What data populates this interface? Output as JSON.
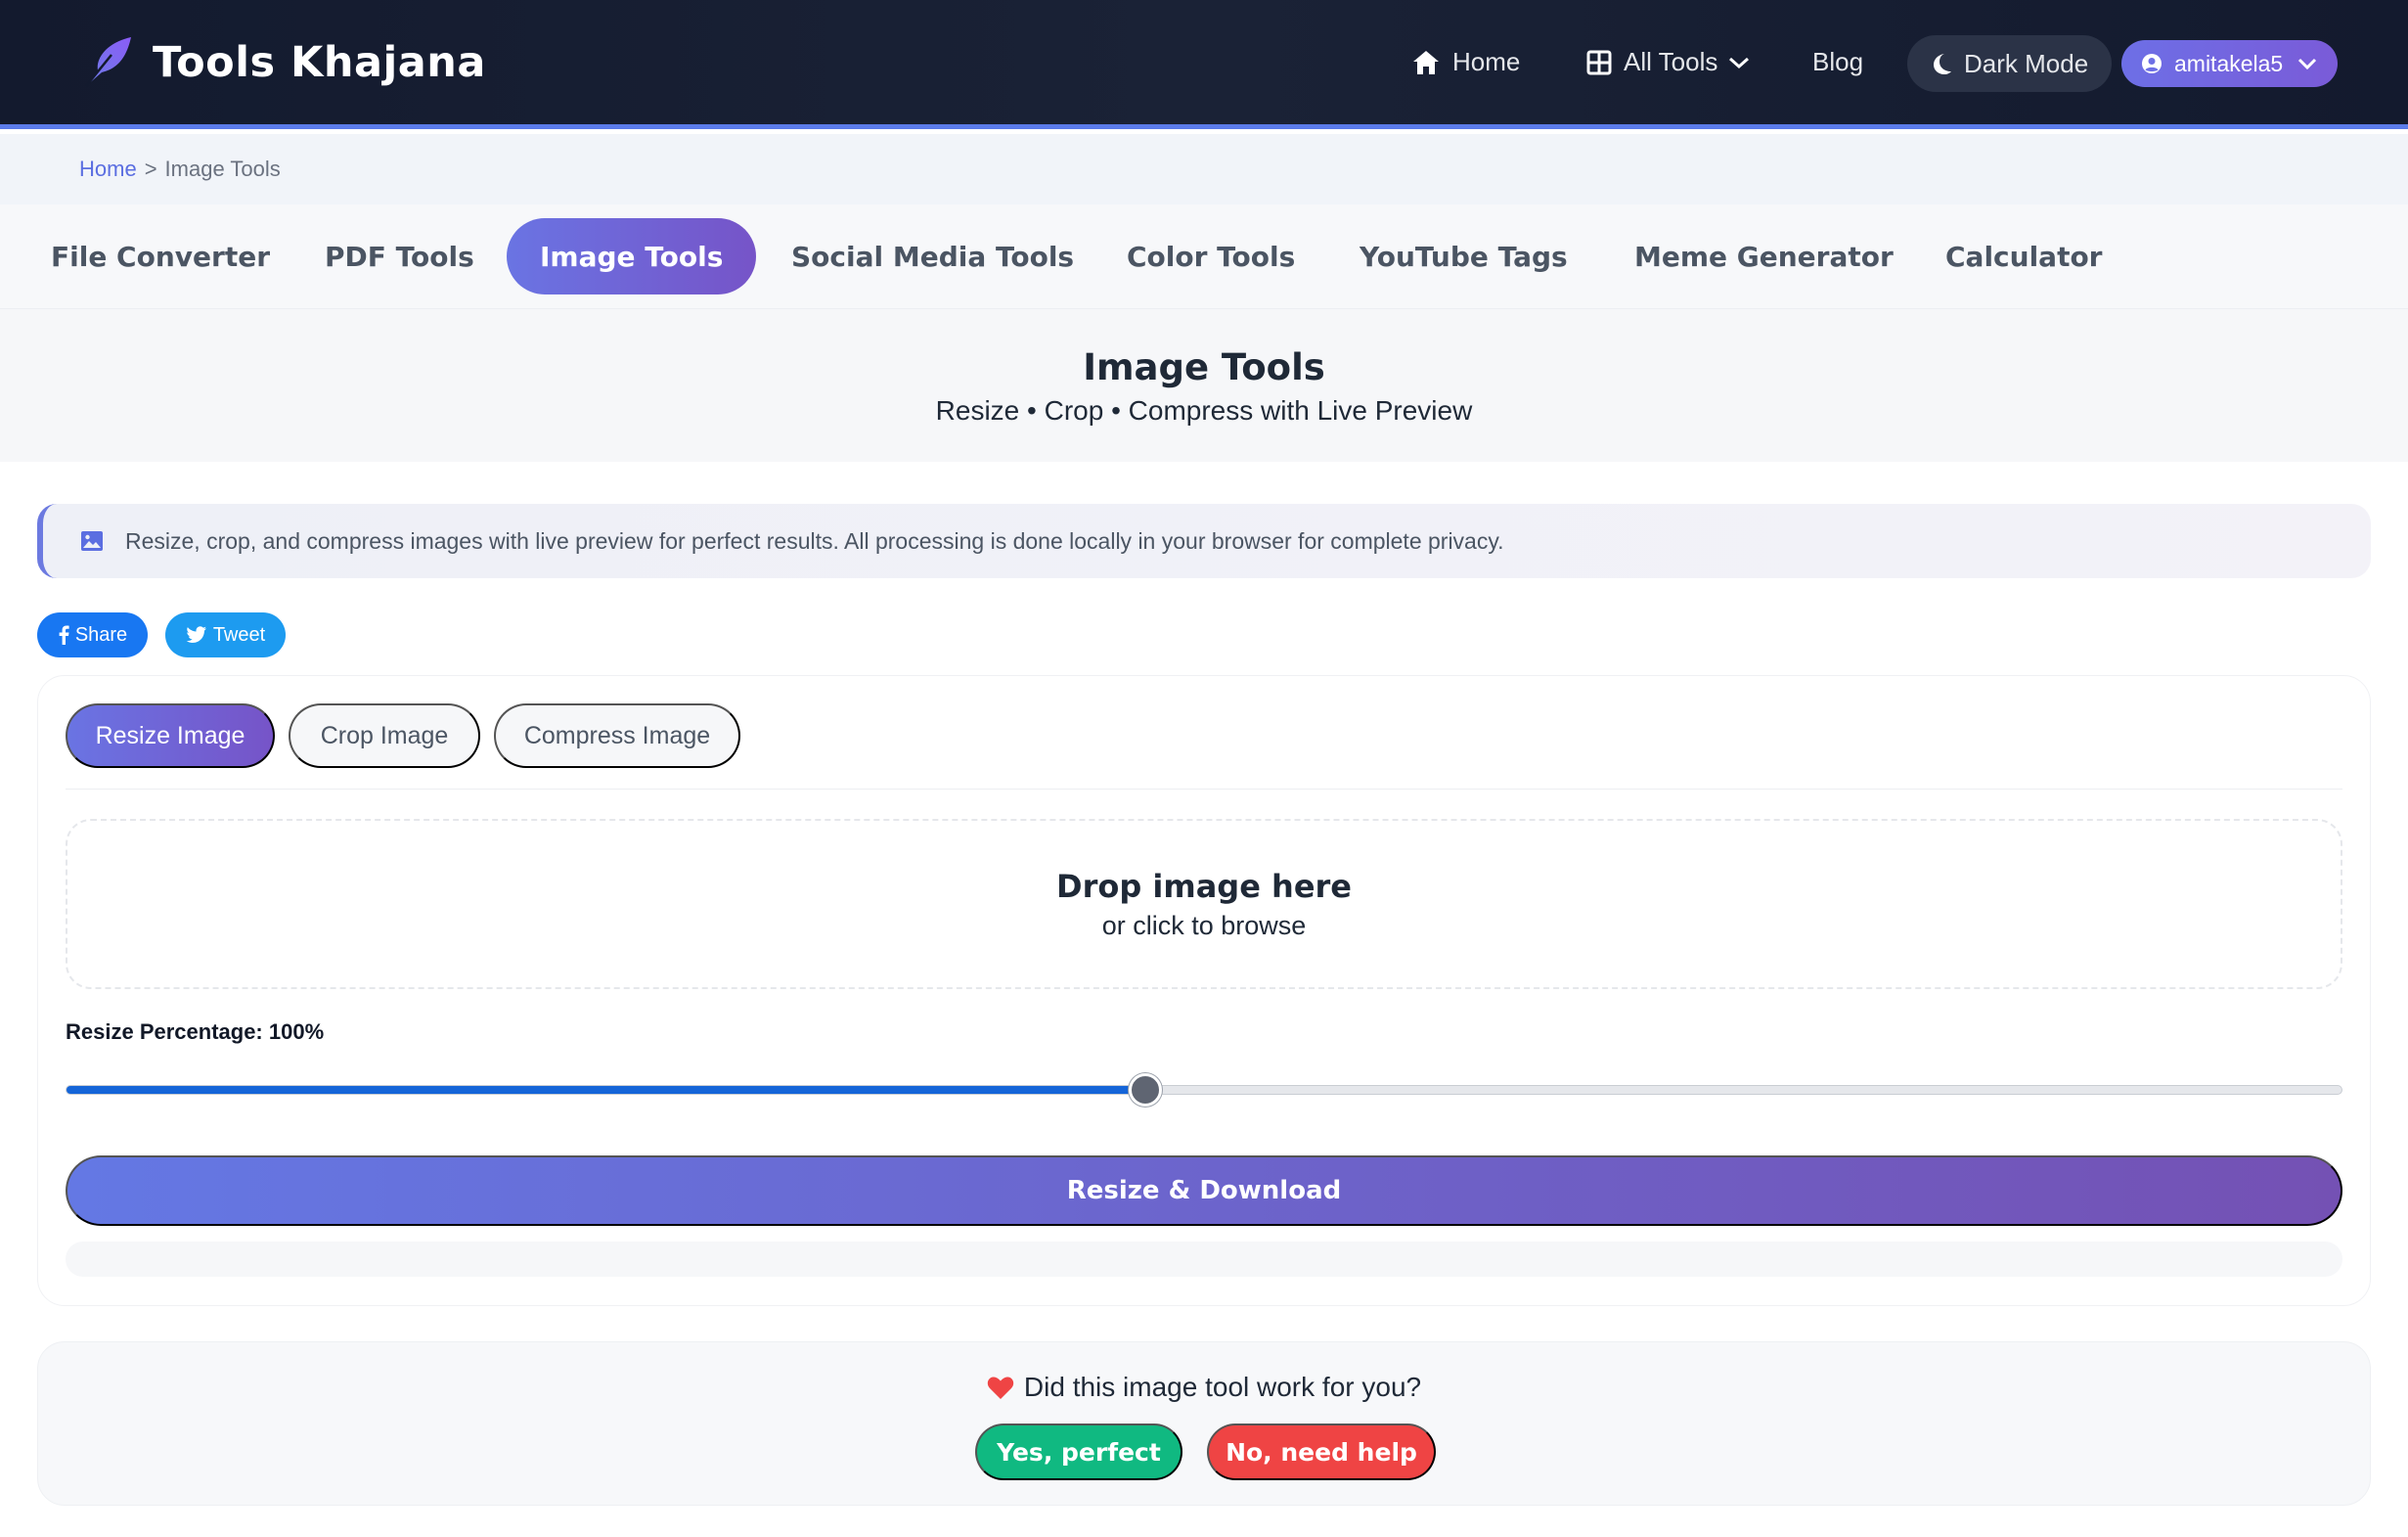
{
  "header": {
    "brand": "Tools Khajana",
    "nav": {
      "home": "Home",
      "all_tools": "All Tools",
      "blog": "Blog",
      "dark_mode": "Dark Mode",
      "user": "amitakela5"
    }
  },
  "breadcrumb": {
    "home": "Home",
    "separator": ">",
    "current": "Image Tools"
  },
  "categories": [
    {
      "label": "File Converter",
      "active": false
    },
    {
      "label": "PDF Tools",
      "active": false
    },
    {
      "label": "Image Tools",
      "active": true
    },
    {
      "label": "Social Media Tools",
      "active": false
    },
    {
      "label": "Color Tools",
      "active": false
    },
    {
      "label": "YouTube Tags",
      "active": false
    },
    {
      "label": "Meme Generator",
      "active": false
    },
    {
      "label": "Calculator",
      "active": false
    }
  ],
  "hero": {
    "title": "Image Tools",
    "subtitle": "Resize • Crop • Compress with Live Preview"
  },
  "info": {
    "text": "Resize, crop, and compress images with live preview for perfect results. All processing is done locally in your browser for complete privacy."
  },
  "share": {
    "share_label": "Share",
    "tweet_label": "Tweet"
  },
  "tool": {
    "tabs": [
      {
        "label": "Resize Image",
        "active": true
      },
      {
        "label": "Crop Image",
        "active": false
      },
      {
        "label": "Compress Image",
        "active": false
      }
    ],
    "dropzone": {
      "title": "Drop image here",
      "subtitle": "or click to browse"
    },
    "resize_label": "Resize Percentage: 100%",
    "resize_percent": 100,
    "slider_fraction": 0.474,
    "action_label": "Resize & Download"
  },
  "feedback": {
    "question": "Did this image tool work for you?",
    "yes_label": "Yes, perfect",
    "no_label": "No, need help"
  },
  "colors": {
    "accent": "#6a74e3",
    "accent_end": "#7654c8",
    "header_bg": "#131a2e",
    "facebook": "#1877f2",
    "twitter": "#1d9bf0",
    "yes": "#10b981",
    "no": "#ef4444",
    "slider_fill": "#1565d8"
  },
  "icons": {
    "logo": "feather-icon",
    "home": "home-icon",
    "all_tools": "grid-icon",
    "dark_mode": "moon-icon",
    "user": "user-circle-icon",
    "info": "image-icon",
    "share": "facebook-icon",
    "tweet": "twitter-icon",
    "feedback": "heart-icon"
  }
}
